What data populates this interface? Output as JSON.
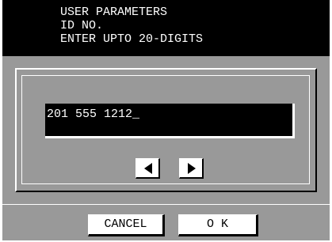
{
  "header": {
    "line1": "USER PARAMETERS",
    "line2": "ID NO.",
    "line3": "ENTER UPTO 20-DIGITS"
  },
  "id_field": {
    "value": "201 555 1212_"
  },
  "cursor_nav": {
    "left_icon": "left-triangle-arrow",
    "right_icon": "right-triangle-arrow"
  },
  "buttons": {
    "cancel": "CANCEL",
    "ok": "O K"
  },
  "colors": {
    "header_bg": "#000000",
    "header_text": "#ffffff",
    "field_bg": "#000000",
    "field_text": "#ffffff",
    "button_bg": "#ffffff",
    "dither_bg": "#c8c8c8"
  }
}
